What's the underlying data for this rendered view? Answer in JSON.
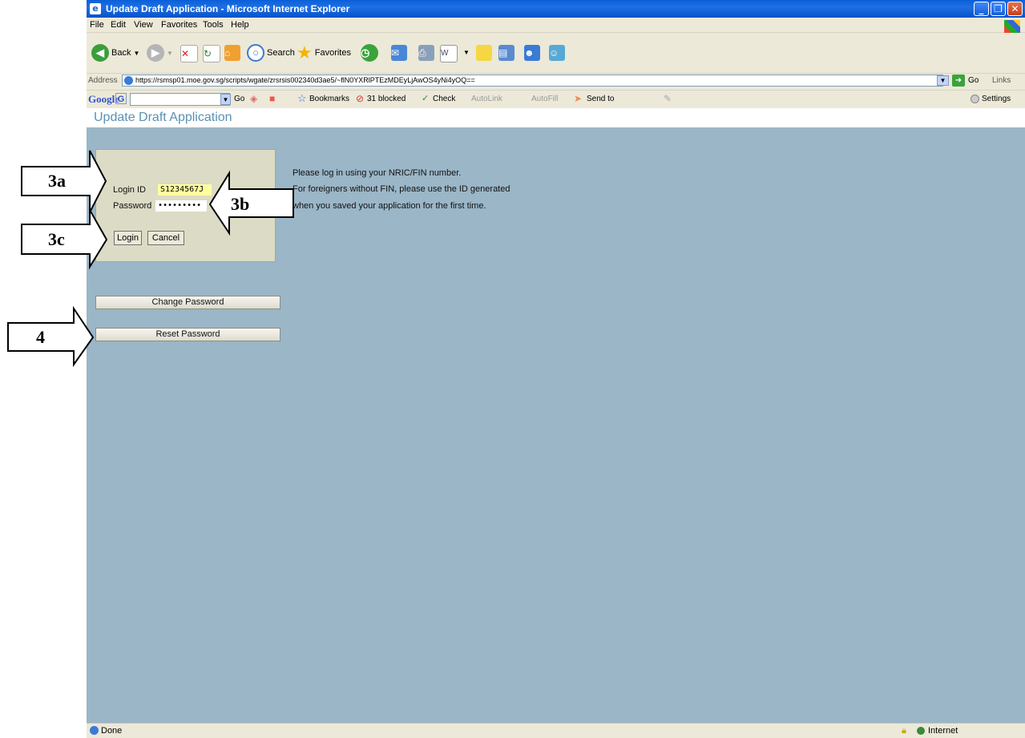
{
  "window": {
    "title": "Update Draft Application - Microsoft Internet Explorer",
    "controls": [
      "minimize",
      "restore",
      "close"
    ]
  },
  "menu": [
    "File",
    "Edit",
    "View",
    "Favorites",
    "Tools",
    "Help"
  ],
  "toolbar": {
    "back_label": "Back",
    "search_label": "Search",
    "favorites_label": "Favorites"
  },
  "address": {
    "label": "Address",
    "url": "https://rsmsp01.moe.gov.sg/scripts/wgate/zrsrsis002340d3ae5/~flN0YXRlPTEzMDEyLjAwOS4yNi4yOQ==",
    "go_label": "Go",
    "links_label": "Links"
  },
  "googlebar": {
    "logo": "Google",
    "go_label": "Go",
    "bookmarks_label": "Bookmarks",
    "blocked_label": "31 blocked",
    "check_label": "Check",
    "autolink_label": "AutoLink",
    "autofill_label": "AutoFill",
    "sendto_label": "Send to",
    "settings_label": "Settings"
  },
  "page": {
    "title": "Update Draft Application",
    "login_id_label": "Login ID",
    "login_id_value": "S1234567J",
    "password_label": "Password",
    "password_value": "•••••••••",
    "login_button": "Login",
    "cancel_button": "Cancel",
    "info_lines": [
      "Please log in using your NRIC/FIN number.",
      "For foreigners without FIN, please use the ID generated",
      "when you saved your application for the first time."
    ],
    "change_password_button": "Change Password",
    "reset_password_button": "Reset Password"
  },
  "status": {
    "text": "Done",
    "zone": "Internet"
  },
  "callouts": {
    "a": "3a",
    "b": "3b",
    "c": "3c",
    "d": "4"
  },
  "colors": {
    "page_bg": "#9ab6c7",
    "title_blue": "#5b90b6",
    "panel_bg": "#dcdbc5",
    "login_field_bg": "#ffffa0"
  }
}
